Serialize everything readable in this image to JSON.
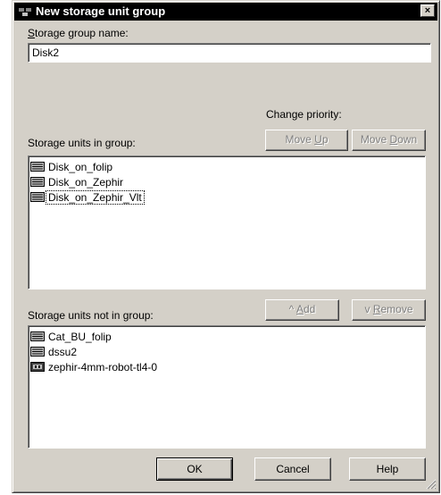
{
  "dialog": {
    "title": "New storage unit group",
    "close_label": "×"
  },
  "group_name": {
    "label_prefix": "S",
    "label_rest": "torage group name:",
    "value": "Disk2"
  },
  "priority": {
    "label": "Change priority:",
    "move_up_prefix": "Move ",
    "move_up_mnemonic": "U",
    "move_up_rest": "p",
    "move_down_prefix": "Move ",
    "move_down_mnemonic": "D",
    "move_down_rest": "own"
  },
  "in_group": {
    "label": "Storage units in group:",
    "items": [
      "Disk_on_folip",
      "Disk_on_Zephir",
      "Disk_on_Zephir_Vlt"
    ]
  },
  "transfer": {
    "add_prefix": "^ ",
    "add_mnemonic": "A",
    "add_rest": "dd",
    "remove_prefix": "v ",
    "remove_mnemonic": "R",
    "remove_rest": "emove"
  },
  "not_in_group": {
    "label": "Storage units not in group:",
    "items": [
      "Cat_BU_folip",
      "dssu2",
      "zephir-4mm-robot-tl4-0"
    ]
  },
  "footer": {
    "ok_label": "OK",
    "cancel_label": "Cancel",
    "help_label": "Help"
  },
  "icons": {
    "disk": "disk-drive-icon",
    "tape": "tape-robot-icon",
    "title": "storage-group-icon"
  }
}
